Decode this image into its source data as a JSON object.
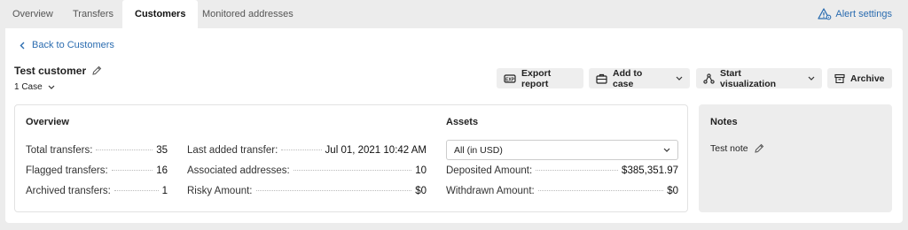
{
  "tabs": [
    {
      "label": "Overview"
    },
    {
      "label": "Transfers"
    },
    {
      "label": "Customers"
    },
    {
      "label": "Monitored addresses"
    }
  ],
  "alert_settings_label": "Alert settings",
  "back_link_label": "Back to Customers",
  "customer": {
    "name": "Test customer",
    "case_selector": "1 Case"
  },
  "actions": {
    "export_report": "Export report",
    "add_to_case": "Add to case",
    "start_visualization": "Start visualization",
    "archive": "Archive"
  },
  "overview": {
    "title": "Overview",
    "col1": [
      {
        "label": "Total transfers:",
        "value": "35"
      },
      {
        "label": "Flagged transfers:",
        "value": "16"
      },
      {
        "label": "Archived transfers:",
        "value": "1"
      }
    ],
    "col2": [
      {
        "label": "Last added transfer:",
        "value": "Jul 01, 2021 10:42 AM"
      },
      {
        "label": "Associated addresses:",
        "value": "10"
      },
      {
        "label": "Risky Amount:",
        "value": "$0"
      }
    ]
  },
  "assets": {
    "title": "Assets",
    "select_value": "All (in USD)",
    "rows": [
      {
        "label": "Deposited Amount:",
        "value": "$385,351.97"
      },
      {
        "label": "Withdrawn Amount:",
        "value": "$0"
      }
    ]
  },
  "notes": {
    "title": "Notes",
    "note": "Test note"
  },
  "colors": {
    "link": "#2b6cb0",
    "button_bg": "#eeeeee",
    "notes_bg": "#ededed"
  }
}
